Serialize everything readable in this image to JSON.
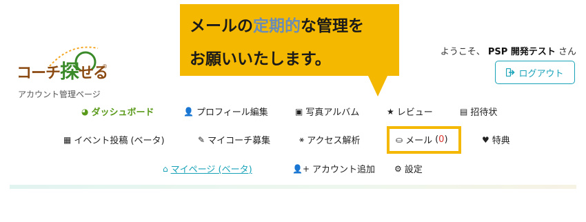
{
  "logo": {
    "text_part1": "コーチ",
    "text_part2": "探",
    "text_part3": "せる",
    "reg": "®",
    "subtitle": "アカウント管理ページ"
  },
  "callout": {
    "line1_a": "メールの",
    "line1_b": "定期的",
    "line1_c": "な管理を",
    "line2": "お願いいたします。"
  },
  "header": {
    "welcome_prefix": "ようこそ、",
    "user_name": "PSP 開発テスト",
    "welcome_suffix": "さん",
    "logout_label": "ログアウト"
  },
  "nav": {
    "row1": [
      {
        "label": "ダッシュボード",
        "icon": "dashboard-icon"
      },
      {
        "label": "プロフィール編集",
        "icon": "user-icon"
      },
      {
        "label": "写真アルバム",
        "icon": "image-icon"
      },
      {
        "label": "レビュー",
        "icon": "star-icon"
      },
      {
        "label": "招待状",
        "icon": "invitation-icon"
      }
    ],
    "row2": [
      {
        "label": "イベント投稿 (ベータ)",
        "icon": "calendar-icon"
      },
      {
        "label": "マイコーチ募集",
        "icon": "edit-user-icon"
      },
      {
        "label": "アクセス解析",
        "icon": "analytics-icon"
      },
      {
        "label": "メール",
        "count": "0",
        "icon": "inbox-icon"
      },
      {
        "label": "特典",
        "icon": "heart-icon"
      }
    ],
    "row3": [
      {
        "label": "マイページ (ベータ)",
        "icon": "home-icon"
      },
      {
        "label": "アカウント追加",
        "icon": "add-user-icon"
      },
      {
        "label": "設定",
        "icon": "gear-icon"
      }
    ]
  },
  "colors": {
    "accent_yellow": "#f5b800",
    "teal": "#17a2b8",
    "active_green": "#5a9a1a",
    "mail_count_red": "#d9302c"
  }
}
